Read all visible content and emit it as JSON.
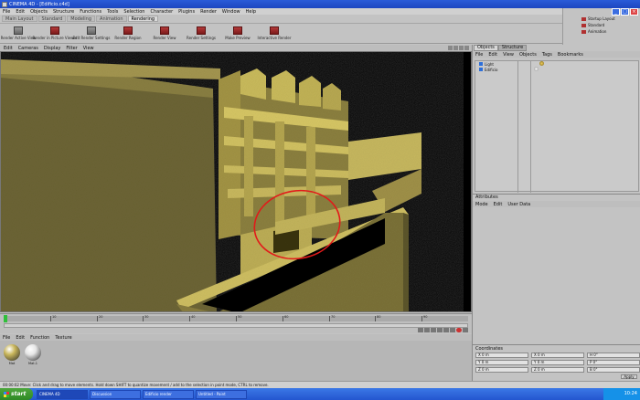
{
  "window": {
    "title": "CINEMA 4D - [Edificio.c4d]"
  },
  "menubar": {
    "items": [
      "File",
      "Edit",
      "Objects",
      "Structure",
      "Functions",
      "Tools",
      "Selection",
      "Character",
      "Plugins",
      "Render",
      "Window",
      "Help"
    ]
  },
  "palette_tabs": [
    "Main Layout",
    "Standard",
    "Modeling",
    "Animation",
    "Rendering"
  ],
  "toolbar": {
    "buttons": [
      "Render Active View",
      "Render in Picture Viewer",
      "Edit Render Settings",
      "Render Region",
      "Render View",
      "Render Settings",
      "Make Preview",
      "Interactive Render"
    ]
  },
  "layout_list": {
    "items": [
      "Startup Layout",
      "Standard",
      "Animation"
    ]
  },
  "viewport": {
    "menu": [
      "Edit",
      "Cameras",
      "Display",
      "Filter",
      "View"
    ]
  },
  "timeline": {
    "ticks": [
      "0",
      "10",
      "20",
      "30",
      "40",
      "50",
      "60",
      "70",
      "80",
      "90"
    ]
  },
  "materials": {
    "menu": [
      "File",
      "Edit",
      "Function",
      "Texture"
    ],
    "items": [
      {
        "name": "Mat",
        "color": "#c9b65b"
      },
      {
        "name": "Mat.1",
        "color": "#e6e6e6"
      }
    ]
  },
  "objects": {
    "tabs": [
      "Objects",
      "Structure"
    ],
    "menu": [
      "File",
      "Edit",
      "View",
      "Objects",
      "Tags",
      "Bookmarks"
    ],
    "rows": [
      "Light",
      "Edificio"
    ]
  },
  "attributes": {
    "title": "Attributes",
    "menu": [
      "Mode",
      "Edit",
      "User Data"
    ]
  },
  "coordinates": {
    "title": "Coordinates",
    "fields": [
      "X 0 m",
      "X 0 m",
      "H 0°",
      "Y 0 m",
      "Y 0 m",
      "P 0°",
      "Z 0 m",
      "Z 0 m",
      "B 0°"
    ],
    "apply": "Apply"
  },
  "status": {
    "text": "00:00:02 Move: Click and drag to move elements. Hold down SHIFT to quantize movement / add to the selection in point mode, CTRL to remove."
  },
  "taskbar": {
    "start": "start",
    "tasks": [
      "CINEMA 4D",
      "Discussion",
      "Edificio render",
      "Untitled - Paint"
    ],
    "clock": "10:24"
  }
}
